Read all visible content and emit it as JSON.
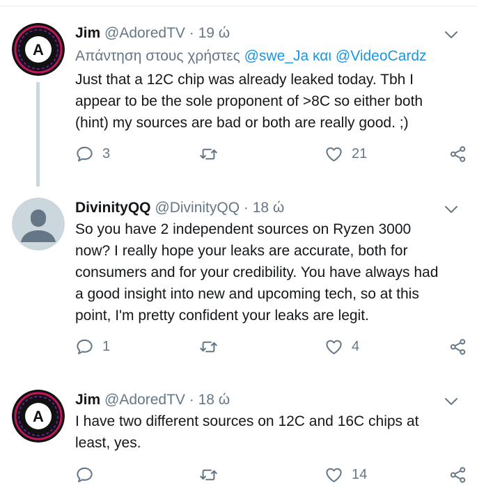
{
  "tweets": [
    {
      "name": "Jim",
      "handle": "@AdoredTV",
      "sep": "·",
      "time": "19 ώ",
      "reply_prefix": "Απάντηση στους χρήστες",
      "mention1": "@swe_Ja",
      "reply_and": "και",
      "mention2": "@VideoCardz",
      "text": "Just that a 12C chip was already leaked today.  Tbh I\nappear to be the sole proponent of >8C so either both\n(hint) my sources are bad or both are really good. ;)",
      "replies": "3",
      "retweets": "",
      "likes": "21",
      "avatar_letter": "A"
    },
    {
      "name": "DivinityQQ",
      "handle": "@DivinityQQ",
      "sep": "·",
      "time": "18 ώ",
      "text": "So you have 2 independent sources on Ryzen 3000\nnow? I really hope your leaks are accurate, both for\nconsumers and for your credibility. You have always had\na good insight into new and upcoming tech, so at this\npoint, I'm pretty confident your leaks are legit.",
      "replies": "1",
      "retweets": "",
      "likes": "4"
    },
    {
      "name": "Jim",
      "handle": "@AdoredTV",
      "sep": "·",
      "time": "18 ώ",
      "text": "I have two different sources on 12C and 16C chips at\nleast, yes.",
      "replies": "",
      "retweets": "",
      "likes": "14",
      "avatar_letter": "A"
    }
  ],
  "icons": {
    "reply": "reply-icon",
    "retweet": "retweet-icon",
    "like": "heart-icon",
    "share": "share-icon",
    "caret": "chevron-down-icon"
  },
  "colors": {
    "text": "#14171a",
    "secondary": "#657786",
    "link": "#1b95e0",
    "thread_line": "#ccd6dd",
    "divider": "#e6ecf0"
  }
}
